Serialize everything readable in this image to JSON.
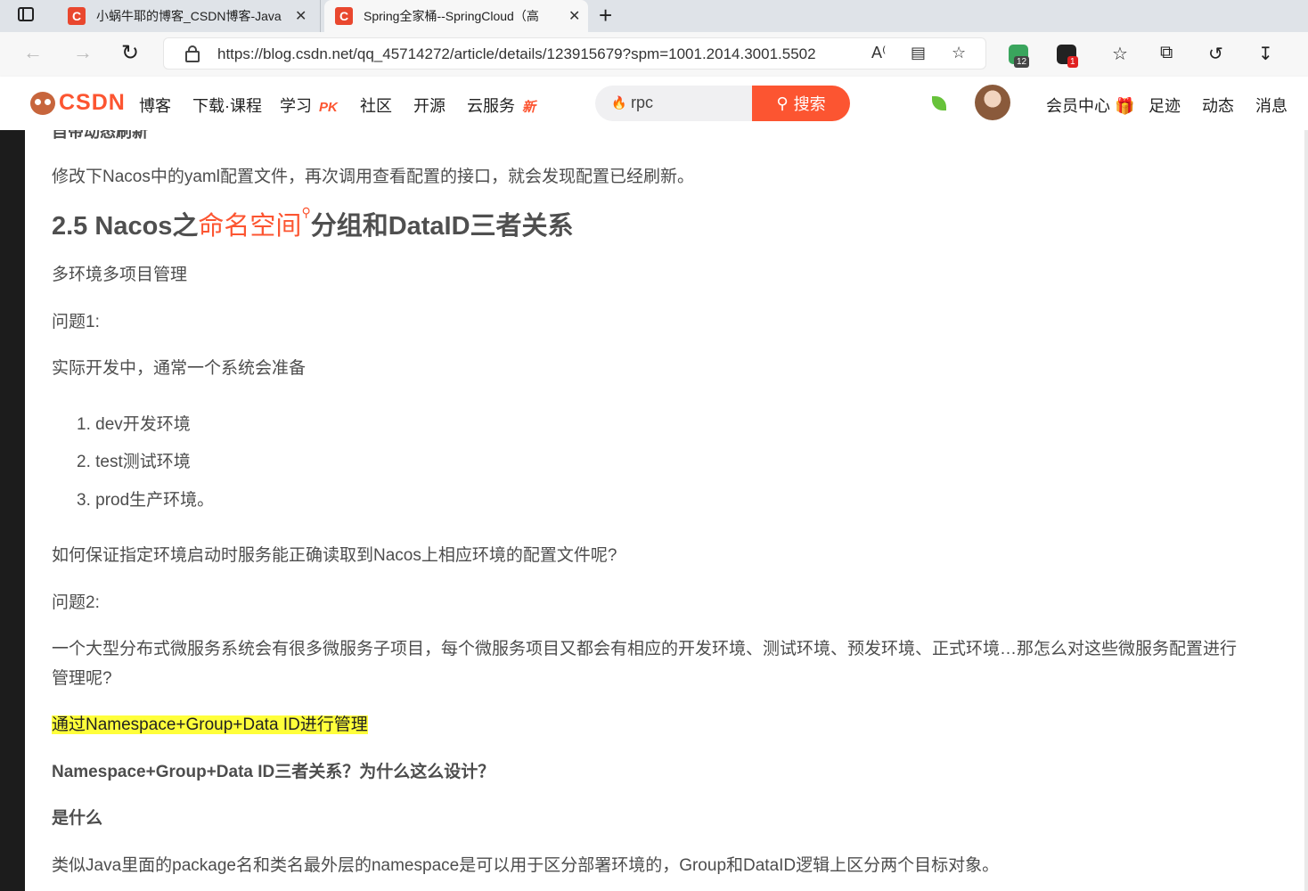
{
  "browser": {
    "tabs": [
      {
        "favicon": "C",
        "title": "小蜗牛耶的博客_CSDN博客-Java",
        "close": "✕"
      },
      {
        "favicon": "C",
        "title": "Spring全家桶--SpringCloud（高",
        "close": "✕"
      }
    ],
    "new_tab": "+",
    "url": "https://blog.csdn.net/qq_45714272/article/details/123915679?spm=1001.2014.3001.5502",
    "read_aloud": "Á",
    "extensions": {
      "badge1": "12",
      "badge2": "1"
    }
  },
  "csdn": {
    "logo_text": "CSDN",
    "nav": [
      {
        "label": "博客"
      },
      {
        "label": "下载·课程"
      },
      {
        "label": "学习",
        "tag": "PK"
      },
      {
        "label": "社区"
      },
      {
        "label": "开源"
      },
      {
        "label": "云服务",
        "tag": "新"
      }
    ],
    "search_value": "rpc",
    "search_button": "搜索",
    "right_nav": [
      "会员中心",
      "足迹",
      "动态",
      "消息"
    ]
  },
  "article": {
    "cut_heading": "自带动态刷新",
    "p_refresh": "修改下Nacos中的yaml配置文件，再次调用查看配置的接口，就会发现配置已经刷新。",
    "h2_prefix": "2.5 Nacos之",
    "h2_keyword": "命名空间",
    "h2_suffix": "分组和DataID三者关系",
    "p_multi": "多环境多项目管理",
    "q1": "问题1:",
    "p_dev": "实际开发中，通常一个系统会准备",
    "list": [
      "1. dev开发环境",
      "2. test测试环境",
      "3. prod生产环境。"
    ],
    "p_how": "如何保证指定环境启动时服务能正确读取到Nacos上相应环境的配置文件呢?",
    "q2": "问题2:",
    "p_large_1": "一个大型分布式微服务系统会有很多微服务子项目，每个微服务项目又都会有相应的开发环境、测试环境、预发环境、正式环境…那怎么对这些微服务配置进行",
    "p_large_2": "管理呢?",
    "highlight": "通过Namespace+Group+Data ID进行管理",
    "bold_q": "Namespace+Group+Data ID三者关系？为什么这么设计？",
    "bold_what": "是什么",
    "p_java": "类似Java里面的package名和类名最外层的namespace是可以用于区分部署环境的，Group和DataID逻辑上区分两个目标对象。"
  }
}
